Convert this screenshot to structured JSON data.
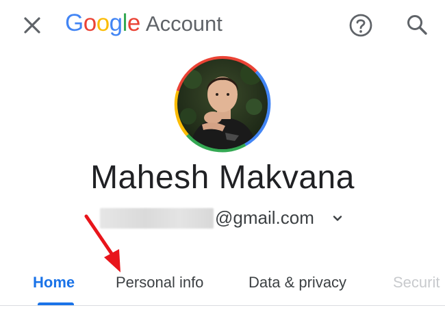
{
  "header": {
    "logo_text": "Google",
    "product_text": "Account",
    "logo_colors": [
      "#4285F4",
      "#EA4335",
      "#FBBC05",
      "#4285F4",
      "#34A853",
      "#EA4335"
    ],
    "close_icon": "close-icon",
    "help_icon": "help-circle-icon",
    "search_icon": "search-icon"
  },
  "profile": {
    "name": "Mahesh Makvana",
    "email_domain": "@gmail.com",
    "email_dropdown_icon": "chevron-down-icon",
    "ring_colors": [
      "#EA4335",
      "#4285F4",
      "#34A853",
      "#FBBC05"
    ]
  },
  "tabs": [
    {
      "label": "Home",
      "active": true
    },
    {
      "label": "Personal info",
      "active": false
    },
    {
      "label": "Data & privacy",
      "active": false
    },
    {
      "label": "Securit",
      "active": false
    }
  ],
  "annotation": {
    "type": "red-arrow",
    "color": "#E8151B",
    "points_to": "Personal info"
  },
  "colors": {
    "accent": "#1a73e8",
    "text": "#202124",
    "icon_gray": "#5f6368"
  }
}
